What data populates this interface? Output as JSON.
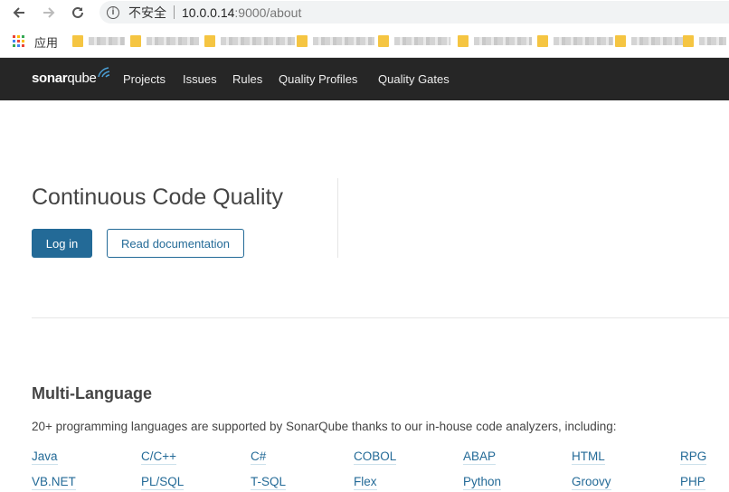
{
  "browser": {
    "insecure_label": "不安全",
    "url_host": "10.0.0.14",
    "url_path": ":9000/about",
    "bookmarks_apps_label": "应用"
  },
  "nav": {
    "logo_sonar": "sonar",
    "logo_qube": "qube",
    "links": [
      "Projects",
      "Issues",
      "Rules",
      "Quality Profiles",
      "Quality Gates"
    ]
  },
  "hero": {
    "title": "Continuous Code Quality",
    "login_label": "Log in",
    "docs_label": "Read documentation"
  },
  "multi_language": {
    "title": "Multi-Language",
    "description": "20+ programming languages are supported by SonarQube thanks to our in-house code analyzers, including:",
    "row1": [
      "Java",
      "C/C++",
      "C#",
      "COBOL",
      "ABAP",
      "HTML",
      "RPG"
    ],
    "row2": [
      "VB.NET",
      "PL/SQL",
      "T-SQL",
      "Flex",
      "Python",
      "Groovy",
      "PHP"
    ]
  },
  "colors": {
    "nav_bg": "#262626",
    "accent": "#236a97"
  }
}
